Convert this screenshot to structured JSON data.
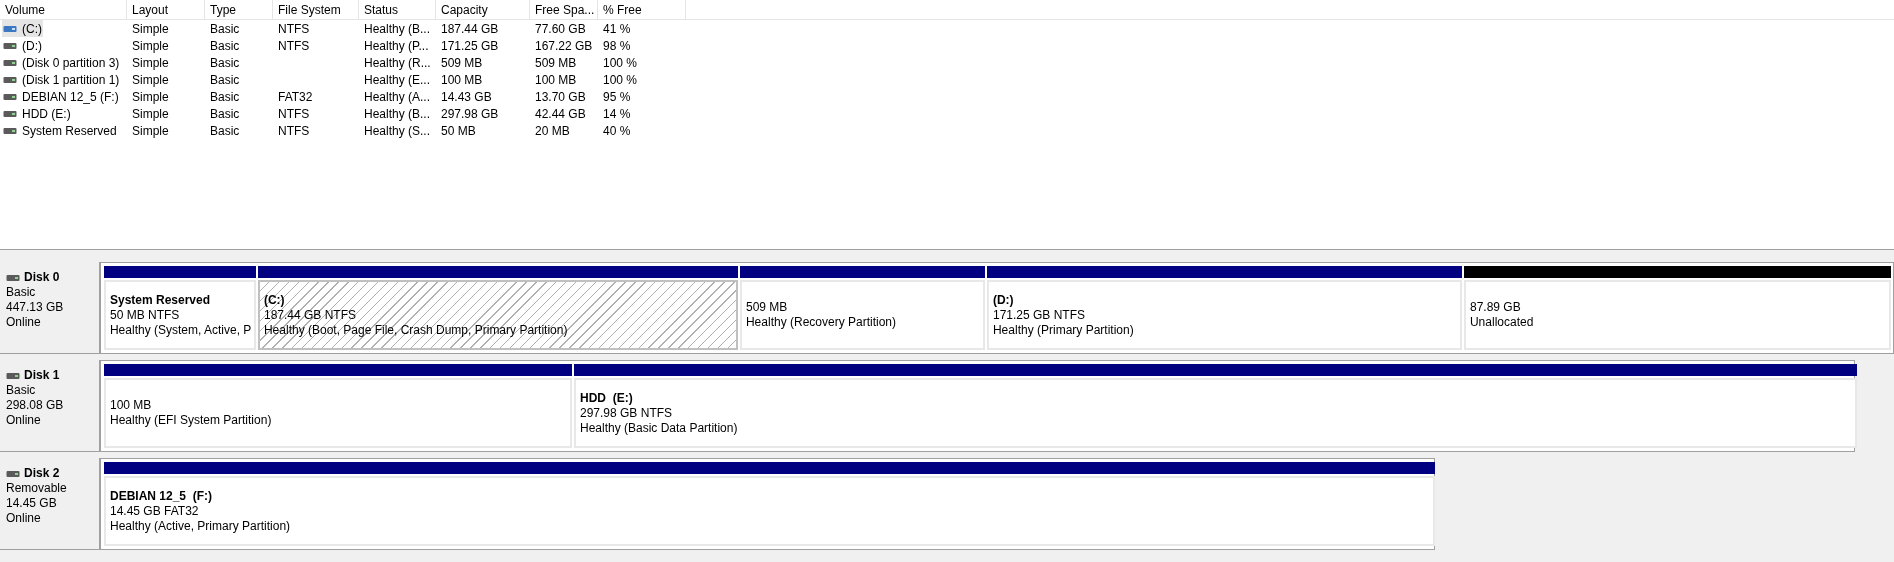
{
  "volume_list": {
    "columns": [
      "Volume",
      "Layout",
      "Type",
      "File System",
      "Status",
      "Capacity",
      "Free Spa...",
      "% Free"
    ],
    "rows": [
      {
        "cells": [
          "(C:)",
          "Simple",
          "Basic",
          "NTFS",
          "Healthy (B...",
          "187.44 GB",
          "77.60 GB",
          "41 %"
        ],
        "selected": true
      },
      {
        "cells": [
          "(D:)",
          "Simple",
          "Basic",
          "NTFS",
          "Healthy (P...",
          "171.25 GB",
          "167.22 GB",
          "98 %"
        ],
        "selected": false
      },
      {
        "cells": [
          "(Disk 0 partition 3)",
          "Simple",
          "Basic",
          "",
          "Healthy (R...",
          "509 MB",
          "509 MB",
          "100 %"
        ],
        "selected": false
      },
      {
        "cells": [
          "(Disk 1 partition 1)",
          "Simple",
          "Basic",
          "",
          "Healthy (E...",
          "100 MB",
          "100 MB",
          "100 %"
        ],
        "selected": false
      },
      {
        "cells": [
          "DEBIAN 12_5 (F:)",
          "Simple",
          "Basic",
          "FAT32",
          "Healthy (A...",
          "14.43 GB",
          "13.70 GB",
          "95 %"
        ],
        "selected": false
      },
      {
        "cells": [
          "HDD (E:)",
          "Simple",
          "Basic",
          "NTFS",
          "Healthy (B...",
          "297.98 GB",
          "42.44 GB",
          "14 %"
        ],
        "selected": false
      },
      {
        "cells": [
          "System Reserved",
          "Simple",
          "Basic",
          "NTFS",
          "Healthy (S...",
          "50 MB",
          "20 MB",
          "40 %"
        ],
        "selected": false
      }
    ]
  },
  "disks": [
    {
      "name": "Disk 0",
      "type": "Basic",
      "size": "447.13 GB",
      "state": "Online",
      "partitions": [
        {
          "kind": "primary",
          "name": "System Reserved",
          "size": "50 MB NTFS",
          "status": "Healthy (System, Active, P",
          "selected": false
        },
        {
          "kind": "primary",
          "name": "(C:)",
          "size": "187.44 GB NTFS",
          "status": "Healthy (Boot, Page File, Crash Dump, Primary Partition)",
          "selected": true
        },
        {
          "kind": "primary",
          "size": "509 MB",
          "status": "Healthy (Recovery Partition)",
          "selected": false
        },
        {
          "kind": "primary",
          "name": "(D:)",
          "size": "171.25 GB NTFS",
          "status": "Healthy (Primary Partition)",
          "selected": false
        },
        {
          "kind": "unallocated",
          "size": "87.89 GB",
          "status": "Unallocated",
          "selected": false
        }
      ]
    },
    {
      "name": "Disk 1",
      "type": "Basic",
      "size": "298.08 GB",
      "state": "Online",
      "partitions": [
        {
          "kind": "primary",
          "size": "100 MB",
          "status": "Healthy (EFI System Partition)",
          "selected": false
        },
        {
          "kind": "primary",
          "name": "HDD  (E:)",
          "size": "297.98 GB NTFS",
          "status": "Healthy (Basic Data Partition)",
          "selected": false
        }
      ]
    },
    {
      "name": "Disk 2",
      "type": "Removable",
      "size": "14.45 GB",
      "state": "Online",
      "partitions": [
        {
          "kind": "primary",
          "name": "DEBIAN 12_5  (F:)",
          "size": "14.45 GB FAT32",
          "status": "Healthy (Active, Primary Partition)",
          "selected": false
        }
      ]
    }
  ]
}
